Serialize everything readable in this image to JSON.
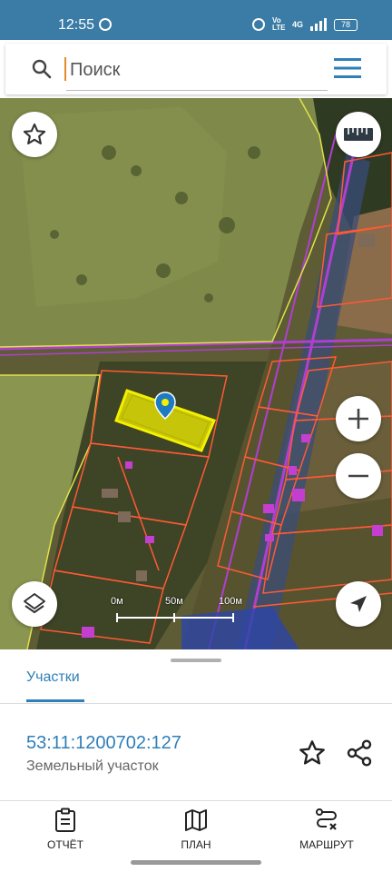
{
  "status_bar": {
    "time": "12:55",
    "volte": "Vo LTE",
    "network": "4G",
    "battery": "78"
  },
  "search": {
    "placeholder": "Поиск"
  },
  "map": {
    "scale_labels": [
      "0м",
      "50м",
      "100м"
    ]
  },
  "sheet": {
    "tab_label": "Участки",
    "cadastral_number": "53:11:1200702:127",
    "parcel_type": "Земельный участок"
  },
  "bottom_nav": {
    "report": "ОТЧЁТ",
    "plan": "ПЛАН",
    "route": "МАРШРУТ"
  },
  "colors": {
    "status_bar": "#3a7ca5",
    "accent": "#2f7fb8",
    "parcel_highlight": "#f4f000",
    "parcel_border": "#ff5a36",
    "road_line": "#b03fd1"
  },
  "icons": [
    "search-icon",
    "menu-icon",
    "star-icon",
    "ruler-icon",
    "layers-icon",
    "zoom-in-icon",
    "zoom-out-icon",
    "navigation-arrow-icon",
    "location-pin-icon",
    "share-icon",
    "report-icon",
    "map-icon",
    "route-icon"
  ]
}
